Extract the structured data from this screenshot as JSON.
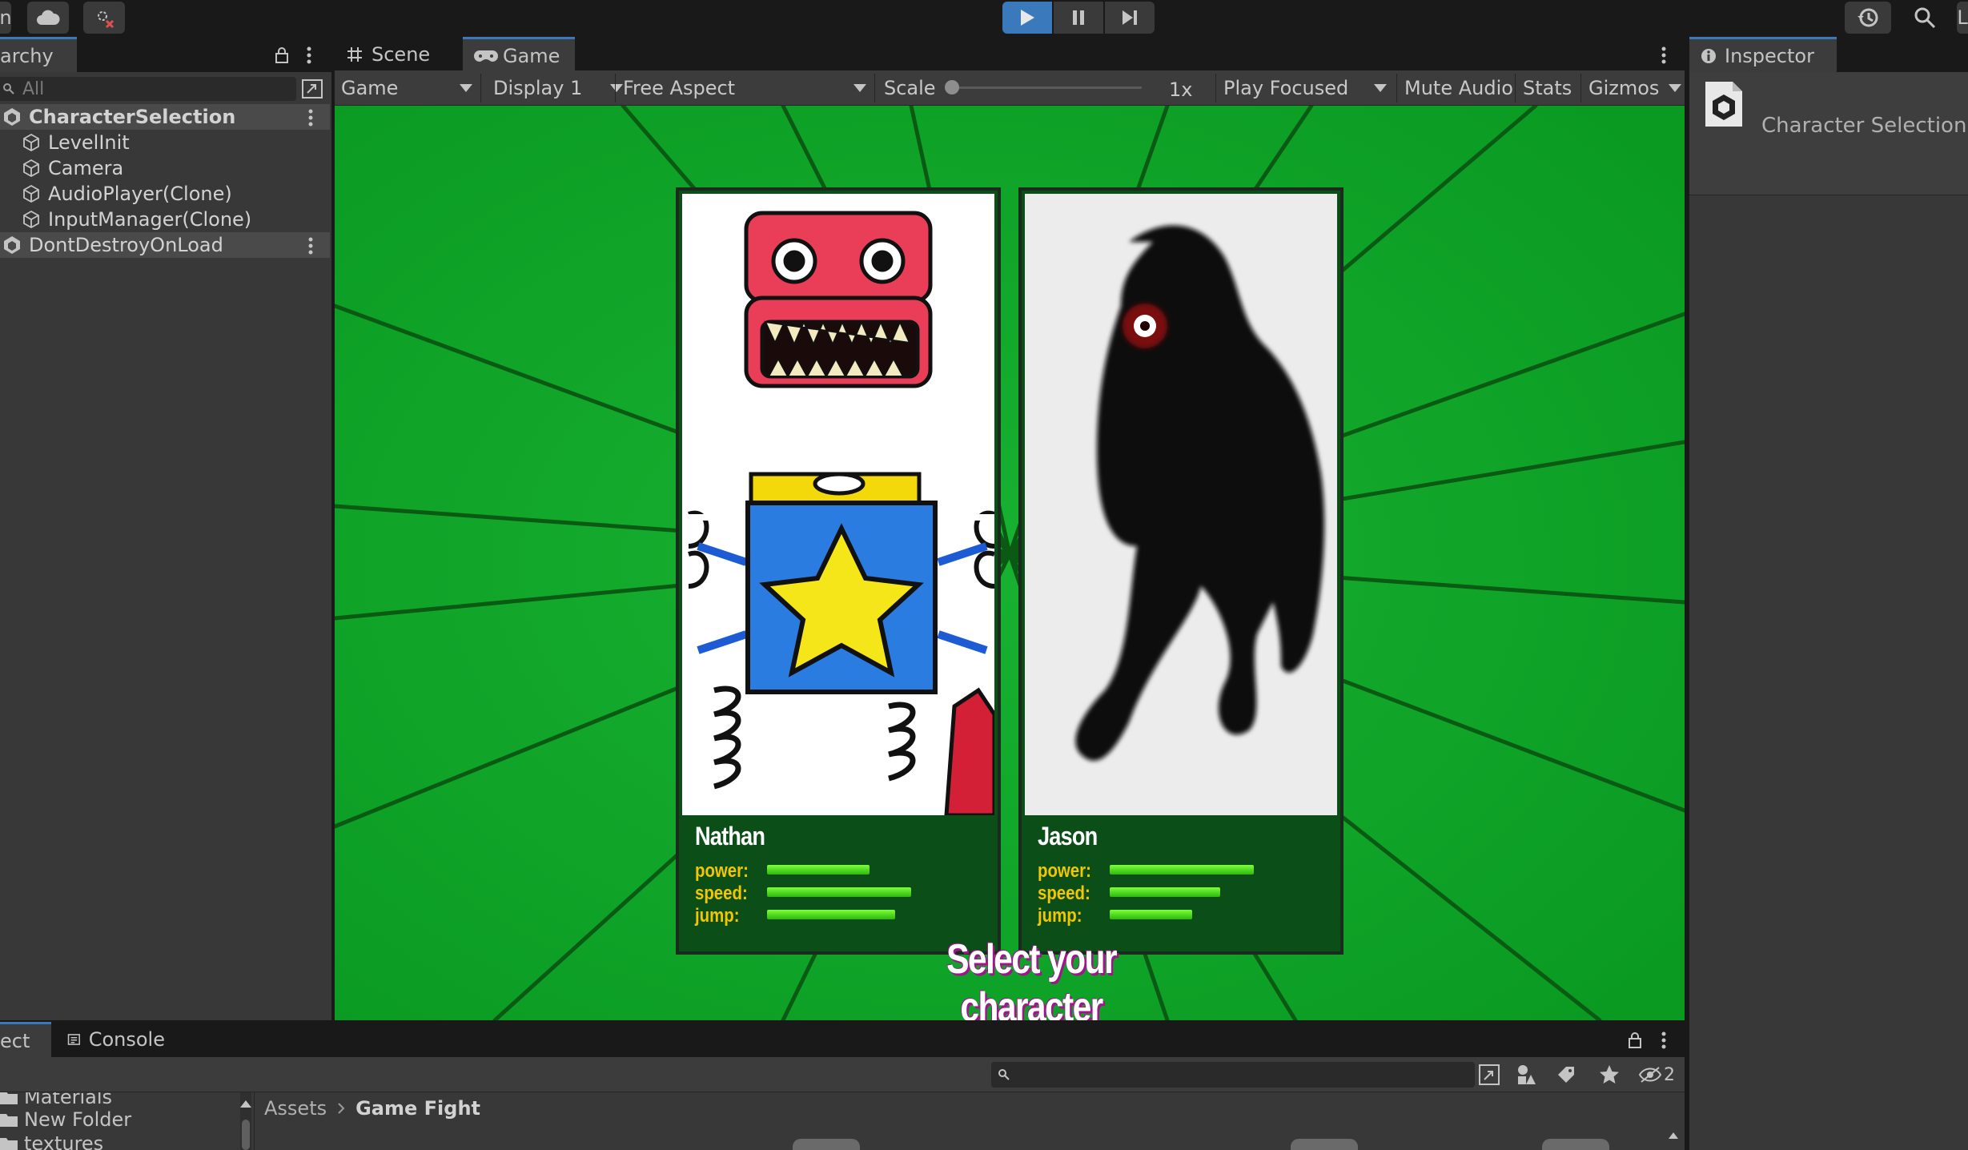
{
  "toolbar": {
    "left_fragment": "n",
    "cloud_icon": "cloud-icon",
    "collab_icon": "collab-icon",
    "play_icon": "play-icon",
    "pause_icon": "pause-icon",
    "step_icon": "step-icon",
    "history_icon": "history-icon",
    "search_icon": "search-icon",
    "right_fragment": "L",
    "play_active_color": "#3a79bb"
  },
  "hierarchy": {
    "tab_label": "archy",
    "search_placeholder": "All",
    "items": [
      {
        "label": "CharacterSelection",
        "type": "scene"
      },
      {
        "label": "LevelInit",
        "type": "object"
      },
      {
        "label": "Camera",
        "type": "object"
      },
      {
        "label": "AudioPlayer(Clone)",
        "type": "object"
      },
      {
        "label": "InputManager(Clone)",
        "type": "object"
      },
      {
        "label": "DontDestroyOnLoad",
        "type": "scene"
      }
    ]
  },
  "center_tabs": {
    "scene": "Scene",
    "game": "Game"
  },
  "game_toolbar": {
    "view_mode": "Game",
    "display": "Display 1",
    "aspect": "Free Aspect",
    "scale_label": "Scale",
    "scale_value": "1x",
    "scale_slider_fraction": 0,
    "play_mode": "Play Focused",
    "mute_audio": "Mute Audio",
    "stats": "Stats",
    "gizmos": "Gizmos"
  },
  "game_view": {
    "background_color": "#12a12a",
    "characters": [
      {
        "name": "Nathan",
        "stats": [
          {
            "label": "power:",
            "value": 0.51
          },
          {
            "label": "speed:",
            "value": 0.72
          },
          {
            "label": "jump:",
            "value": 0.64
          }
        ]
      },
      {
        "name": "Jason",
        "stats": [
          {
            "label": "power:",
            "value": 0.72
          },
          {
            "label": "speed:",
            "value": 0.55
          },
          {
            "label": "jump:",
            "value": 0.41
          }
        ]
      }
    ],
    "prompt": "Select your character"
  },
  "inspector": {
    "tab_label": "Inspector",
    "object_name": "Character Selection"
  },
  "bottom_panel": {
    "project_tab": "ect",
    "console_tab": "Console",
    "folders": [
      "Materials",
      "New Folder",
      "textures"
    ],
    "breadcrumb": [
      "Assets",
      "Game Fight"
    ],
    "hidden_count": "2"
  }
}
